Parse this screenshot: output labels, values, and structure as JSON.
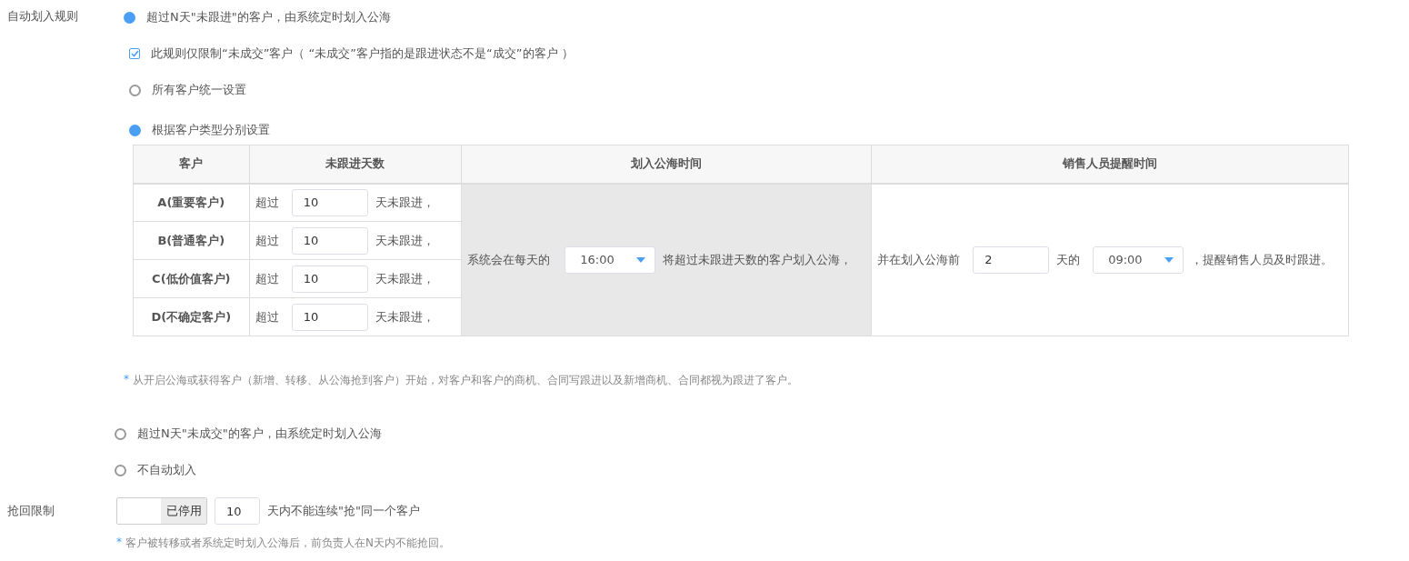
{
  "auto_rule": {
    "label": "自动划入规则",
    "options": [
      {
        "label": "超过N天\"未跟进\"的客户，由系统定时划入公海",
        "selected": true,
        "checkbox": {
          "label": "此规则仅限制“未成交”客户（ “未成交”客户指的是跟进状态不是“成交”的客户 ）",
          "checked": true
        },
        "sub_options": [
          {
            "label": "所有客户统一设置",
            "selected": false
          },
          {
            "label": "根据客户类型分别设置",
            "selected": true
          }
        ],
        "table": {
          "columns": [
            "客户",
            "未跟进天数",
            "划入公海时间",
            "销售人员提醒时间"
          ],
          "rows": [
            {
              "customer": "A(重要客户)",
              "prefix": "超过",
              "days": "10",
              "suffix": "天未跟进，"
            },
            {
              "customer": "B(普通客户)",
              "prefix": "超过",
              "days": "10",
              "suffix": "天未跟进，"
            },
            {
              "customer": "C(低价值客户)",
              "prefix": "超过",
              "days": "10",
              "suffix": "天未跟进，"
            },
            {
              "customer": "D(不确定客户)",
              "prefix": "超过",
              "days": "10",
              "suffix": "天未跟进，"
            }
          ],
          "pool_time": {
            "before": "系统会在每天的",
            "time": "16:00",
            "after": "将超过未跟进天数的客户划入公海，"
          },
          "reminder": {
            "before": "并在划入公海前",
            "days": "2",
            "mid": "天的",
            "time": "09:00",
            "after": "，提醒销售人员及时跟进。"
          }
        },
        "note": {
          "mark": "*",
          "text": "从开启公海或获得客户（新增、转移、从公海抢到客户）开始，对客户和客户的商机、合同写跟进以及新增商机、合同都视为跟进了客户。"
        }
      },
      {
        "label": "超过N天\"未成交\"的客户，由系统定时划入公海",
        "selected": false
      },
      {
        "label": "不自动划入",
        "selected": false
      }
    ]
  },
  "grab_limit": {
    "label": "抢回限制",
    "toggle": {
      "on": false,
      "label": "已停用"
    },
    "days": "10",
    "suffix": "天内不能连续\"抢\"同一个客户",
    "note": {
      "mark": "*",
      "text": "客户被转移或者系统定时划入公海后，前负责人在N天内不能抢回。"
    }
  }
}
